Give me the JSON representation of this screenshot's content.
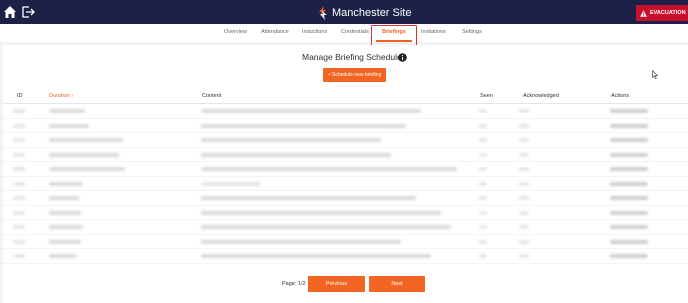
{
  "header": {
    "site_title": "Manchester Site",
    "evacuation_label": "EVACUATION",
    "brand_color": "#1b2147",
    "evacuation_color": "#c8102e"
  },
  "tabs": [
    {
      "label": "Overview"
    },
    {
      "label": "Attendance"
    },
    {
      "label": "Inductions"
    },
    {
      "label": "Credentials"
    },
    {
      "label": "Briefings",
      "active": true
    },
    {
      "label": "Invitations"
    },
    {
      "label": "Settings"
    }
  ],
  "accent_color": "#f26522",
  "main": {
    "title": "Manage Briefing Schedule",
    "schedule_button": "+ Schedule new briefing"
  },
  "table": {
    "columns": [
      "ID",
      "Duration ↑",
      "Content",
      "Seen",
      "Acknowledged",
      "Actions"
    ]
  },
  "pagination": {
    "page_label": "Page: 1/2",
    "previous_label": "Previous",
    "next_label": "Next"
  }
}
